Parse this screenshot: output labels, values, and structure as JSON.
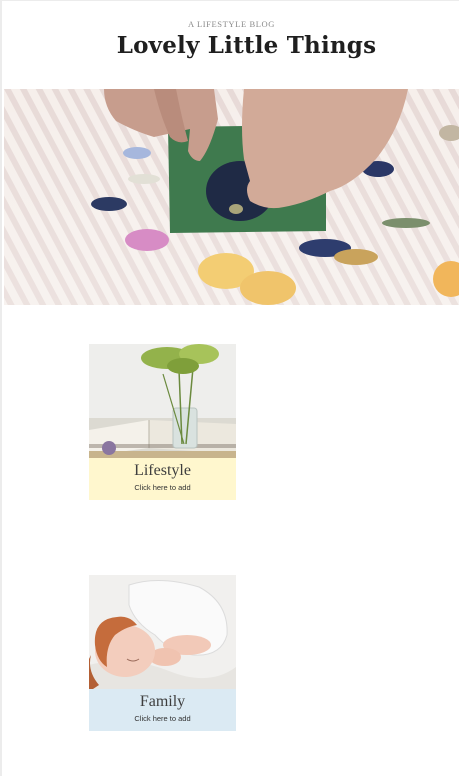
{
  "header": {
    "tagline": "A LIFESTYLE BLOG",
    "title": "Lovely Little Things"
  },
  "hero": {
    "image": "hands-pressed-flowers-photo"
  },
  "cards": [
    {
      "title": "Lifestyle",
      "link": "Click here to add",
      "image": "flower-vase-photo",
      "caption_bg": "#fff7ce"
    },
    {
      "title": "Family",
      "link": "Click here to add",
      "image": "sleeping-child-photo",
      "caption_bg": "#dbeaf3"
    }
  ]
}
